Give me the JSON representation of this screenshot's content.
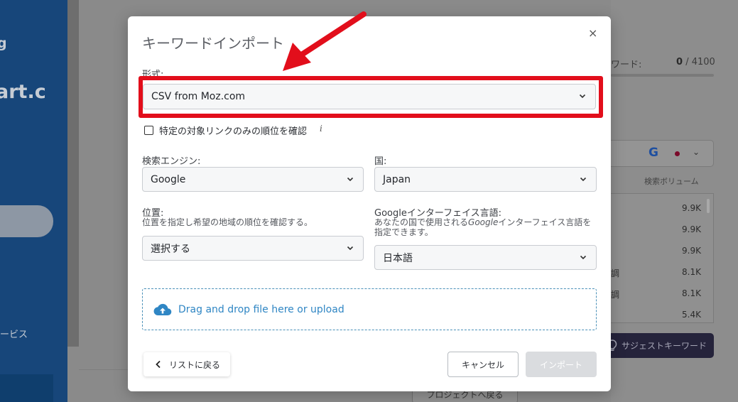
{
  "background": {
    "sidebar_logo_top": "g",
    "sidebar_logo_main": "art.c",
    "sidebar_service": "ービス",
    "keyword_label": "ワード:",
    "keyword_count_used": "0",
    "keyword_count_total": "/ 4100",
    "search_engine_glyph": "G",
    "volume_header": "検索ボリューム",
    "volumes": [
      "9.9K",
      "9.9K",
      "9.9K",
      "8.1K",
      "8.1K",
      "5.4K"
    ],
    "row_fragments": [
      "調",
      "調"
    ],
    "suggest_button": "サジェストキーワード",
    "project_button": "プロジェクトへ戻る"
  },
  "modal": {
    "title": "キーワードインポート",
    "close_glyph": "×",
    "format": {
      "label": "形式:",
      "value": "CSV from Moz.com"
    },
    "checkbox": {
      "label": "特定の対象リンクのみの順位を確認",
      "info": "i",
      "checked": false
    },
    "search_engine": {
      "label": "検索エンジン:",
      "value": "Google"
    },
    "country": {
      "label": "国:",
      "value": "Japan"
    },
    "location": {
      "label": "位置:",
      "description": "位置を指定し希望の地域の順位を確認する。",
      "value": "選択する"
    },
    "interface_language": {
      "label": "Googleインターフェイス言語:",
      "description_prefix": "あなたの国で使用される",
      "description_em": "Google",
      "description_suffix": "インターフェイス言語を",
      "description_line2": "指定できます。",
      "value": "日本語"
    },
    "dropzone": {
      "text": "Drag and drop file here or upload"
    },
    "back_button": "リストに戻る",
    "cancel_button": "キャンセル",
    "import_button": "インポート"
  },
  "colors": {
    "highlight_red": "#e20e1b",
    "link_blue": "#2f86c4",
    "sidebar_blue": "#17467a"
  }
}
